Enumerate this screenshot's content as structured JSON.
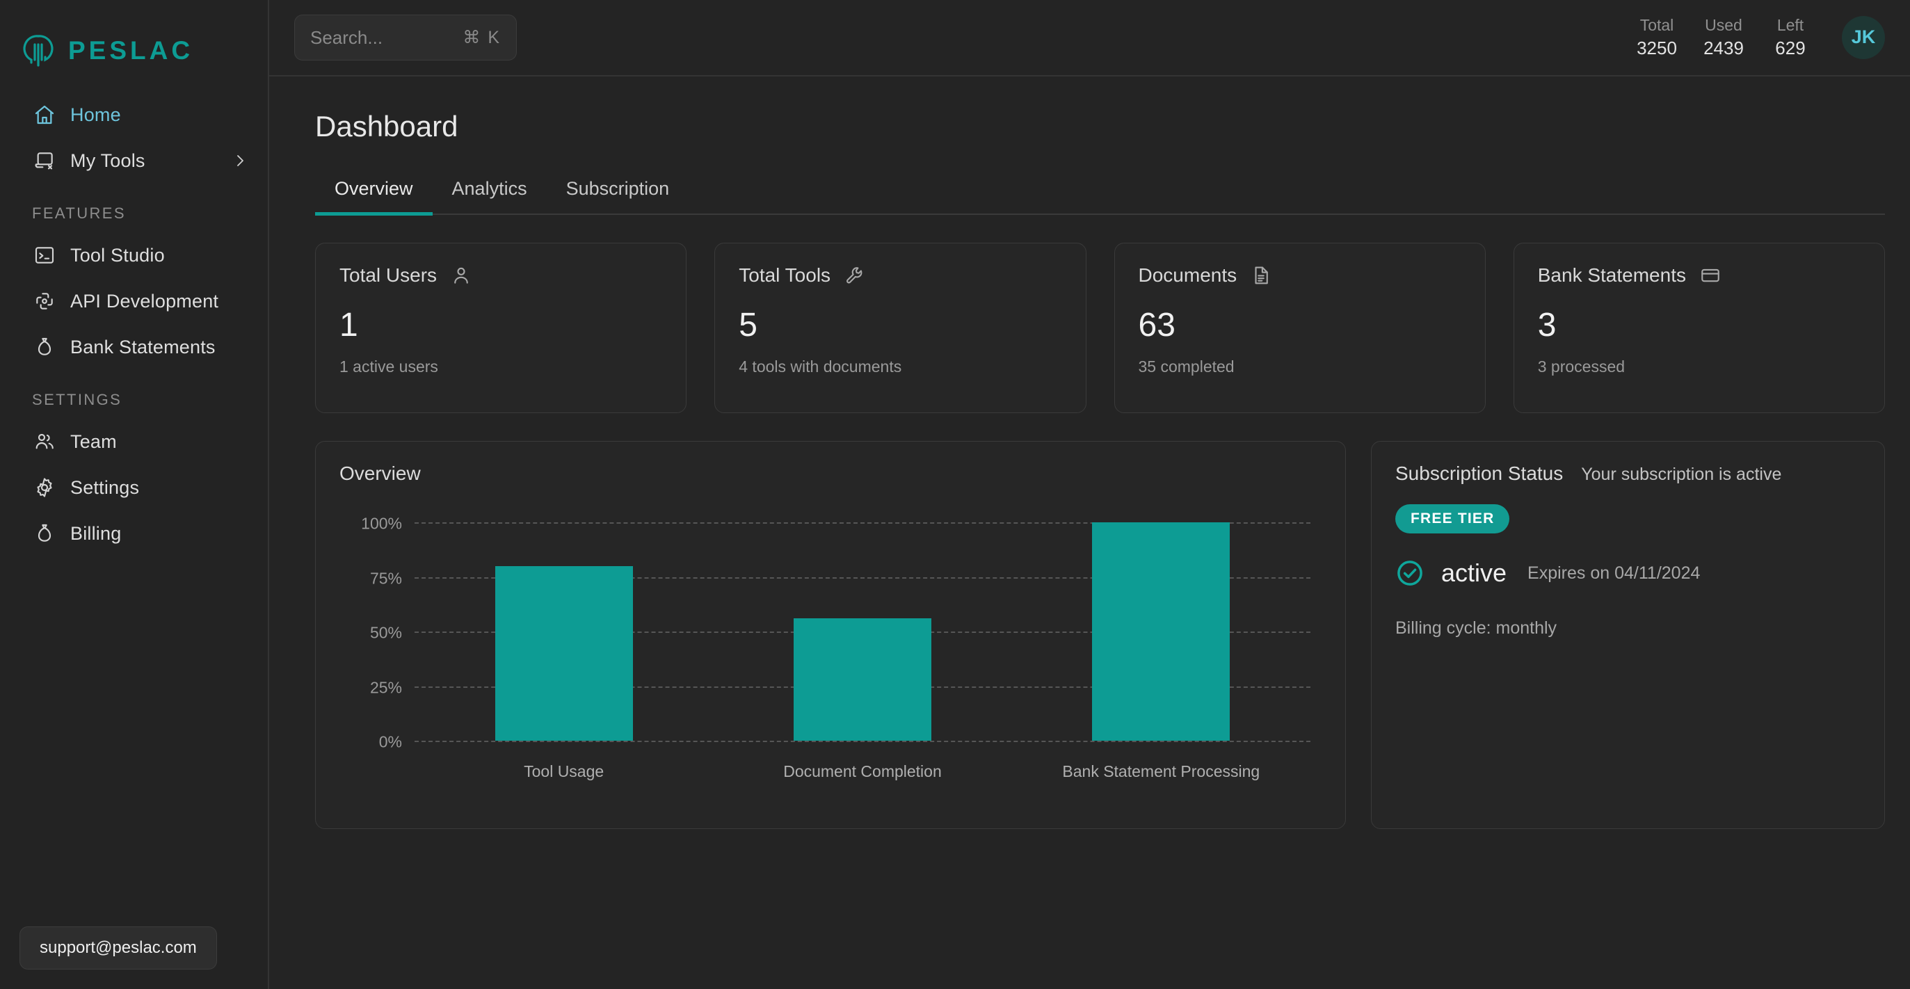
{
  "brand": {
    "name": "PESLAC",
    "logo_icon": "peslac-tree-logo-icon"
  },
  "sidebar": {
    "primary": [
      {
        "label": "Home",
        "icon": "home-icon",
        "active": true
      },
      {
        "label": "My Tools",
        "icon": "tool-window-icon",
        "active": false,
        "chevron": "chevron-right-icon"
      }
    ],
    "sections": [
      {
        "heading": "FEATURES",
        "items": [
          {
            "label": "Tool Studio",
            "icon": "terminal-icon"
          },
          {
            "label": "API Development",
            "icon": "api-nodes-icon"
          },
          {
            "label": "Bank Statements",
            "icon": "money-bag-icon"
          }
        ]
      },
      {
        "heading": "SETTINGS",
        "items": [
          {
            "label": "Team",
            "icon": "users-icon"
          },
          {
            "label": "Settings",
            "icon": "gear-icon"
          },
          {
            "label": "Billing",
            "icon": "money-bag-icon"
          }
        ]
      }
    ],
    "support_email": "support@peslac.com"
  },
  "topbar": {
    "search": {
      "placeholder": "Search...",
      "shortcut": "⌘ K"
    },
    "usage": [
      {
        "label": "Total",
        "value": "3250"
      },
      {
        "label": "Used",
        "value": "2439"
      },
      {
        "label": "Left",
        "value": "629"
      }
    ],
    "avatar_initials": "JK"
  },
  "page": {
    "title": "Dashboard",
    "tabs": [
      {
        "label": "Overview",
        "active": true
      },
      {
        "label": "Analytics",
        "active": false
      },
      {
        "label": "Subscription",
        "active": false
      }
    ]
  },
  "stats": [
    {
      "title": "Total Users",
      "icon": "user-icon",
      "value": "1",
      "sub": "1 active users"
    },
    {
      "title": "Total Tools",
      "icon": "wrench-icon",
      "value": "5",
      "sub": "4 tools with documents"
    },
    {
      "title": "Documents",
      "icon": "document-icon",
      "value": "63",
      "sub": "35 completed"
    },
    {
      "title": "Bank Statements",
      "icon": "credit-card-icon",
      "value": "3",
      "sub": "3 processed"
    }
  ],
  "chart_panel": {
    "title": "Overview"
  },
  "chart_data": {
    "type": "bar",
    "title": "Overview",
    "categories": [
      "Tool Usage",
      "Document Completion",
      "Bank Statement Processing"
    ],
    "values": [
      80,
      56,
      100
    ],
    "value_suffix": "%",
    "xlabel": "",
    "ylabel": "",
    "ylim": [
      0,
      100
    ],
    "yticks": [
      100,
      75,
      50,
      25,
      0
    ],
    "ytick_labels": [
      "100%",
      "75%",
      "50%",
      "25%",
      "0%"
    ],
    "grid": true,
    "grid_style": "dashed",
    "legend": false,
    "bar_color": "#0d9c94"
  },
  "subscription": {
    "title": "Subscription Status",
    "description": "Your subscription is active",
    "tier_badge": "FREE TIER",
    "status_icon": "check-circle-icon",
    "status": "active",
    "expires": "Expires on 04/11/2024",
    "billing_cycle": "Billing cycle: monthly"
  },
  "colors": {
    "accent_teal": "#0d9c94",
    "active_nav": "#6ec5dd",
    "page_bg": "#242424",
    "card_bg": "#262626",
    "card_border": "#3a3a3a"
  }
}
